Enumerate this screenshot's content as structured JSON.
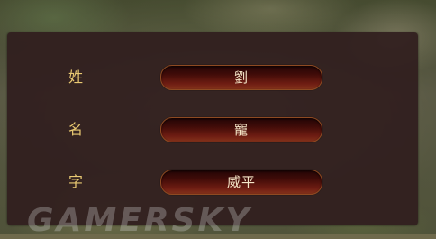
{
  "form": {
    "rows": [
      {
        "label": "姓",
        "value": "劉"
      },
      {
        "label": "名",
        "value": "寵"
      },
      {
        "label": "字",
        "value": "威平"
      }
    ]
  },
  "watermark": "GAMERSKY",
  "colors": {
    "label": "#e9c972",
    "panel": "#301e1e",
    "field_border": "#8e4a22",
    "field_text": "#f5e6c8"
  }
}
